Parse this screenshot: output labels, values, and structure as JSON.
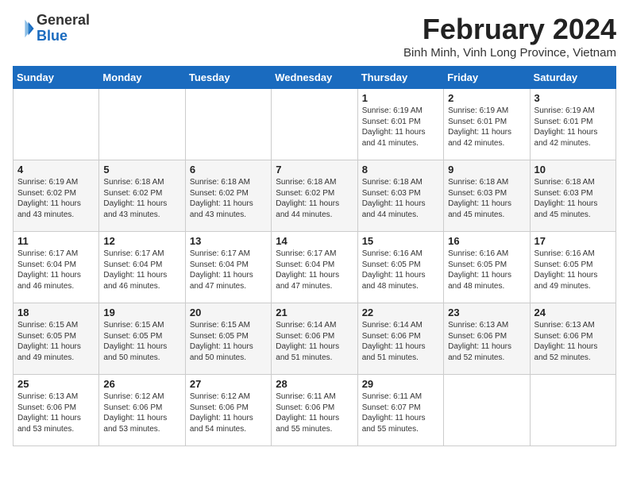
{
  "header": {
    "logo_general": "General",
    "logo_blue": "Blue",
    "month_title": "February 2024",
    "location": "Binh Minh, Vinh Long Province, Vietnam"
  },
  "weekdays": [
    "Sunday",
    "Monday",
    "Tuesday",
    "Wednesday",
    "Thursday",
    "Friday",
    "Saturday"
  ],
  "weeks": [
    [
      {
        "day": "",
        "info": ""
      },
      {
        "day": "",
        "info": ""
      },
      {
        "day": "",
        "info": ""
      },
      {
        "day": "",
        "info": ""
      },
      {
        "day": "1",
        "info": "Sunrise: 6:19 AM\nSunset: 6:01 PM\nDaylight: 11 hours\nand 41 minutes."
      },
      {
        "day": "2",
        "info": "Sunrise: 6:19 AM\nSunset: 6:01 PM\nDaylight: 11 hours\nand 42 minutes."
      },
      {
        "day": "3",
        "info": "Sunrise: 6:19 AM\nSunset: 6:01 PM\nDaylight: 11 hours\nand 42 minutes."
      }
    ],
    [
      {
        "day": "4",
        "info": "Sunrise: 6:19 AM\nSunset: 6:02 PM\nDaylight: 11 hours\nand 43 minutes."
      },
      {
        "day": "5",
        "info": "Sunrise: 6:18 AM\nSunset: 6:02 PM\nDaylight: 11 hours\nand 43 minutes."
      },
      {
        "day": "6",
        "info": "Sunrise: 6:18 AM\nSunset: 6:02 PM\nDaylight: 11 hours\nand 43 minutes."
      },
      {
        "day": "7",
        "info": "Sunrise: 6:18 AM\nSunset: 6:02 PM\nDaylight: 11 hours\nand 44 minutes."
      },
      {
        "day": "8",
        "info": "Sunrise: 6:18 AM\nSunset: 6:03 PM\nDaylight: 11 hours\nand 44 minutes."
      },
      {
        "day": "9",
        "info": "Sunrise: 6:18 AM\nSunset: 6:03 PM\nDaylight: 11 hours\nand 45 minutes."
      },
      {
        "day": "10",
        "info": "Sunrise: 6:18 AM\nSunset: 6:03 PM\nDaylight: 11 hours\nand 45 minutes."
      }
    ],
    [
      {
        "day": "11",
        "info": "Sunrise: 6:17 AM\nSunset: 6:04 PM\nDaylight: 11 hours\nand 46 minutes."
      },
      {
        "day": "12",
        "info": "Sunrise: 6:17 AM\nSunset: 6:04 PM\nDaylight: 11 hours\nand 46 minutes."
      },
      {
        "day": "13",
        "info": "Sunrise: 6:17 AM\nSunset: 6:04 PM\nDaylight: 11 hours\nand 47 minutes."
      },
      {
        "day": "14",
        "info": "Sunrise: 6:17 AM\nSunset: 6:04 PM\nDaylight: 11 hours\nand 47 minutes."
      },
      {
        "day": "15",
        "info": "Sunrise: 6:16 AM\nSunset: 6:05 PM\nDaylight: 11 hours\nand 48 minutes."
      },
      {
        "day": "16",
        "info": "Sunrise: 6:16 AM\nSunset: 6:05 PM\nDaylight: 11 hours\nand 48 minutes."
      },
      {
        "day": "17",
        "info": "Sunrise: 6:16 AM\nSunset: 6:05 PM\nDaylight: 11 hours\nand 49 minutes."
      }
    ],
    [
      {
        "day": "18",
        "info": "Sunrise: 6:15 AM\nSunset: 6:05 PM\nDaylight: 11 hours\nand 49 minutes."
      },
      {
        "day": "19",
        "info": "Sunrise: 6:15 AM\nSunset: 6:05 PM\nDaylight: 11 hours\nand 50 minutes."
      },
      {
        "day": "20",
        "info": "Sunrise: 6:15 AM\nSunset: 6:05 PM\nDaylight: 11 hours\nand 50 minutes."
      },
      {
        "day": "21",
        "info": "Sunrise: 6:14 AM\nSunset: 6:06 PM\nDaylight: 11 hours\nand 51 minutes."
      },
      {
        "day": "22",
        "info": "Sunrise: 6:14 AM\nSunset: 6:06 PM\nDaylight: 11 hours\nand 51 minutes."
      },
      {
        "day": "23",
        "info": "Sunrise: 6:13 AM\nSunset: 6:06 PM\nDaylight: 11 hours\nand 52 minutes."
      },
      {
        "day": "24",
        "info": "Sunrise: 6:13 AM\nSunset: 6:06 PM\nDaylight: 11 hours\nand 52 minutes."
      }
    ],
    [
      {
        "day": "25",
        "info": "Sunrise: 6:13 AM\nSunset: 6:06 PM\nDaylight: 11 hours\nand 53 minutes."
      },
      {
        "day": "26",
        "info": "Sunrise: 6:12 AM\nSunset: 6:06 PM\nDaylight: 11 hours\nand 53 minutes."
      },
      {
        "day": "27",
        "info": "Sunrise: 6:12 AM\nSunset: 6:06 PM\nDaylight: 11 hours\nand 54 minutes."
      },
      {
        "day": "28",
        "info": "Sunrise: 6:11 AM\nSunset: 6:06 PM\nDaylight: 11 hours\nand 55 minutes."
      },
      {
        "day": "29",
        "info": "Sunrise: 6:11 AM\nSunset: 6:07 PM\nDaylight: 11 hours\nand 55 minutes."
      },
      {
        "day": "",
        "info": ""
      },
      {
        "day": "",
        "info": ""
      }
    ]
  ]
}
